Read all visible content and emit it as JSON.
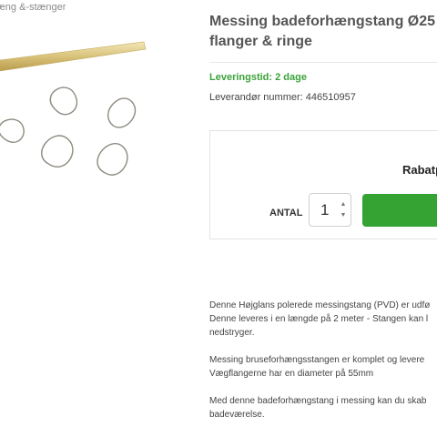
{
  "breadcrumb": "æng &-stænger",
  "product": {
    "title_line1": "Messing badeforhængstang Ø25",
    "title_line2": "flanger & ringe",
    "delivery": "Leveringstid: 2 dage",
    "supplier": "Leverandør nummer: 446510957"
  },
  "buy_box": {
    "discount_label": "Rabatp",
    "qty_label": "ANTAL",
    "qty_value": "1"
  },
  "description": {
    "p1_line1": "Denne Højglans polerede messingstang (PVD) er udfø",
    "p1_line2": "Denne leveres i en længde på 2 meter - Stangen kan l",
    "p1_line3": "nedstryger.",
    "p2_line1": "Messing bruseforhængsstangen er komplet og levere",
    "p2_line2": "Vægflangerne har en diameter på 55mm",
    "p3_line1": "Med denne badeforhængstang i messing kan du skab",
    "p3_line2": "badeværelse."
  },
  "colors": {
    "accent_green": "#34a334",
    "delivery_green": "#3aa23a",
    "brass": "#d9c27a"
  },
  "icons": {
    "qty_up": "chevron-up-icon",
    "qty_down": "chevron-down-icon"
  }
}
